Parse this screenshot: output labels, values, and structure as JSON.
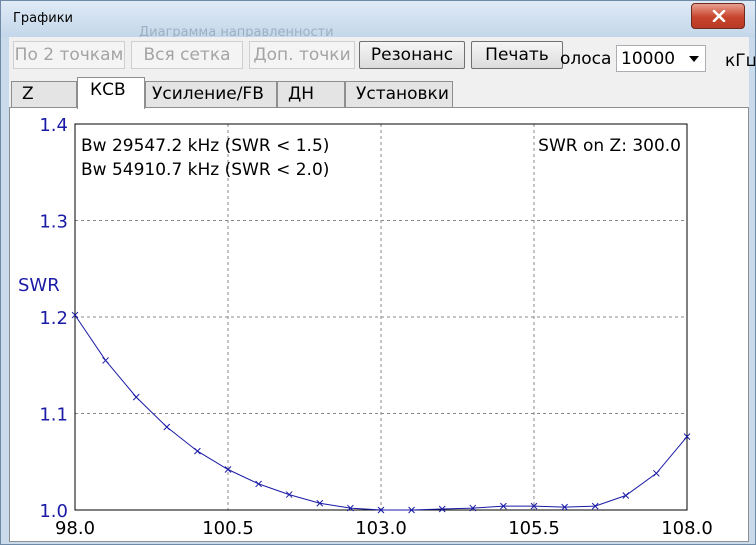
{
  "window": {
    "title": "Графики",
    "behind_title": "Диаграмма направленности"
  },
  "toolbar": {
    "by_two_points": "По 2 точкам",
    "all_grid": "Вся сетка",
    "extra_points": "Доп. точки",
    "resonance": "Резонанс",
    "print": "Печать",
    "band_label": "олоса",
    "band_value": "10000",
    "band_unit": "кГц"
  },
  "tabs": [
    "Z",
    "КСВ",
    "Усиление/FB",
    "ДН",
    "Установки"
  ],
  "selected_tab": 1,
  "colors": {
    "axis_label": "#1a1aa6",
    "curve": "#1a1aa6",
    "close_button": "#c7442c"
  },
  "icons": {
    "close": "close-icon",
    "dropdown": "chevron-down-icon"
  },
  "chart_data": {
    "type": "line",
    "ylabel": "SWR",
    "xlabel": "",
    "xlim": [
      98.0,
      108.0
    ],
    "ylim": [
      1.0,
      1.4
    ],
    "x_ticks": [
      "98.0",
      "100.5",
      "103.0",
      "105.5",
      "108.0"
    ],
    "y_ticks": [
      "1.0",
      "1.1",
      "1.2",
      "1.3",
      "1.4"
    ],
    "grid": true,
    "annotations": {
      "bw15": "Bw 29547.2 kHz (SWR < 1.5)",
      "bw20": "Bw 54910.7 kHz (SWR < 2.0)",
      "swr_on_z": "SWR on Z: 300.0"
    },
    "series": [
      {
        "x": [
          98.0,
          98.5,
          99.0,
          99.5,
          100.0,
          100.5,
          101.0,
          101.5,
          102.0,
          102.5,
          103.0,
          103.5,
          104.0,
          104.5,
          105.0,
          105.5,
          106.0,
          106.5,
          107.0,
          107.5,
          108.0
        ],
        "y": [
          1.202,
          1.155,
          1.117,
          1.086,
          1.061,
          1.042,
          1.027,
          1.016,
          1.007,
          1.002,
          1.0,
          1.0,
          1.001,
          1.002,
          1.004,
          1.004,
          1.003,
          1.004,
          1.015,
          1.038,
          1.076
        ]
      }
    ]
  }
}
